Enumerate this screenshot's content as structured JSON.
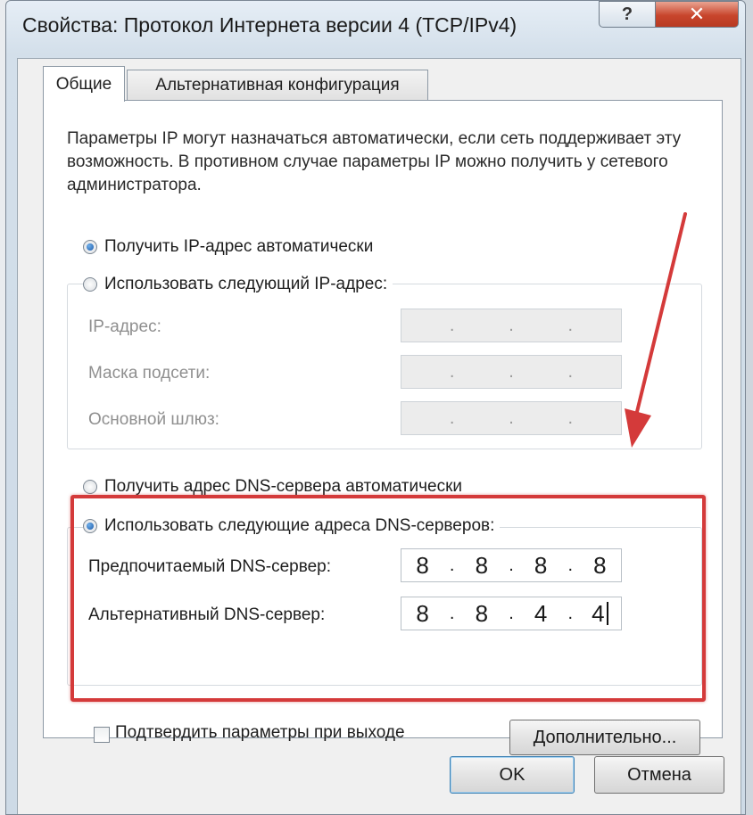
{
  "window": {
    "title": "Свойства: Протокол Интернета версии 4 (TCP/IPv4)",
    "help_label": "?",
    "close_label": "✕"
  },
  "tabs": [
    {
      "label": "Общие",
      "active": true
    },
    {
      "label": "Альтернативная конфигурация",
      "active": false
    }
  ],
  "intro_text": "Параметры IP могут назначаться автоматически, если сеть поддерживает эту возможность. В противном случае параметры IP можно получить у сетевого администратора.",
  "ip": {
    "auto_label": "Получить IP-адрес автоматически",
    "auto_selected": true,
    "manual_label": "Использовать следующий IP-адрес:",
    "manual_selected": false,
    "fields": [
      {
        "label": "IP-адрес:",
        "octets": [
          "",
          "",
          "",
          ""
        ]
      },
      {
        "label": "Маска подсети:",
        "octets": [
          "",
          "",
          "",
          ""
        ]
      },
      {
        "label": "Основной шлюз:",
        "octets": [
          "",
          "",
          "",
          ""
        ]
      }
    ]
  },
  "dns": {
    "auto_label": "Получить адрес DNS-сервера автоматически",
    "auto_selected": false,
    "manual_label": "Использовать следующие адреса DNS-серверов:",
    "manual_selected": true,
    "preferred": {
      "label": "Предпочитаемый DNS-сервер:",
      "octets": [
        "8",
        "8",
        "8",
        "8"
      ]
    },
    "alternate": {
      "label": "Альтернативный DNS-сервер:",
      "octets": [
        "8",
        "8",
        "4",
        "4"
      ]
    }
  },
  "validate_label": "Подтвердить параметры при выходе",
  "validate_checked": false,
  "advanced_label": "Дополнительно...",
  "ok_label": "OK",
  "cancel_label": "Отмена",
  "colors": {
    "highlight": "#d43a3a",
    "accent": "#1c5aa8"
  },
  "icons": [
    "help-icon",
    "close-icon",
    "annotation-arrow-icon"
  ]
}
